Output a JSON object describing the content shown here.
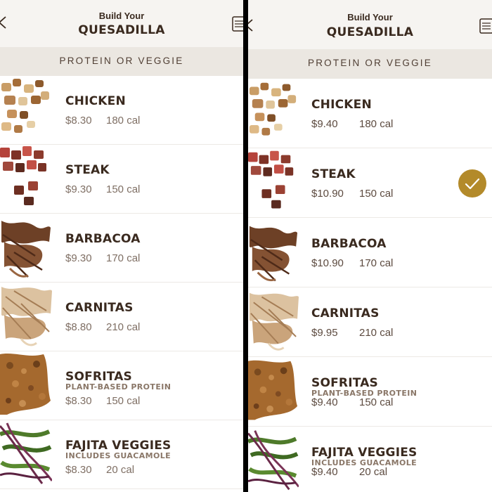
{
  "left": {
    "header_small": "Build Your",
    "header_big": "QUESADILLA",
    "section": "PROTEIN OR VEGGIE",
    "items": [
      {
        "name": "CHICKEN",
        "price": "$8.30",
        "cal": "180 cal"
      },
      {
        "name": "STEAK",
        "price": "$9.30",
        "cal": "150 cal"
      },
      {
        "name": "BARBACOA",
        "price": "$9.30",
        "cal": "170 cal"
      },
      {
        "name": "CARNITAS",
        "price": "$8.80",
        "cal": "210 cal"
      },
      {
        "name": "SOFRITAS",
        "sub": "PLANT-BASED PROTEIN",
        "price": "$8.30",
        "cal": "150 cal"
      },
      {
        "name": "FAJITA VEGGIES",
        "sub": "INCLUDES GUACAMOLE",
        "price": "$8.30",
        "cal": "20 cal"
      }
    ]
  },
  "right": {
    "header_small": "Build Your",
    "header_big": "QUESADILLA",
    "section": "PROTEIN OR VEGGIE",
    "items": [
      {
        "name": "CHICKEN",
        "price": "$9.40",
        "cal": "180 cal"
      },
      {
        "name": "STEAK",
        "price": "$10.90",
        "cal": "150 cal",
        "selected": true
      },
      {
        "name": "BARBACOA",
        "price": "$10.90",
        "cal": "170 cal"
      },
      {
        "name": "CARNITAS",
        "price": "$9.95",
        "cal": "210 cal"
      },
      {
        "name": "SOFRITAS",
        "sub": "PLANT-BASED PROTEIN",
        "price": "$9.40",
        "cal": "150 cal"
      },
      {
        "name": "FAJITA VEGGIES",
        "sub": "INCLUDES GUACAMOLE",
        "price": "$9.40",
        "cal": "20 cal"
      }
    ]
  },
  "icons": {
    "back": "chevron-left-icon",
    "menu": "bag-menu-icon",
    "check": "checkmark-icon"
  },
  "colors": {
    "brand_text": "#3a2a1f",
    "section_bg": "#ebe7e1",
    "header_bg": "#f6f4f1",
    "selected_check": "#b38a2a"
  }
}
